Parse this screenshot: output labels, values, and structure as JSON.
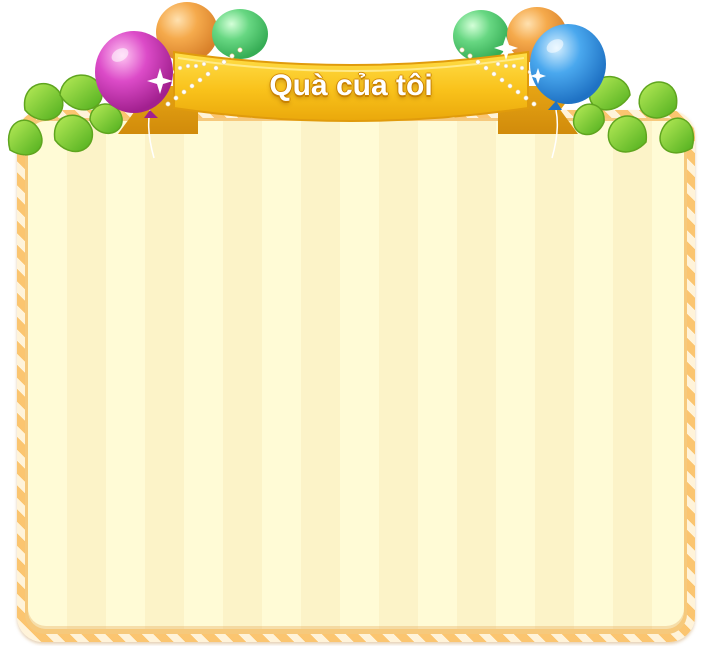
{
  "title": "Quà của tôi",
  "colors": {
    "panel_stripe_light": "#fffbd6",
    "panel_stripe_dark": "#fcf3c8",
    "border_orange": "#fbc570",
    "ribbon_yellow": "#f7c21c",
    "leaf_green": "#7ccf2a"
  },
  "balloons": [
    {
      "name": "pink-balloon",
      "color": "#d33fc1"
    },
    {
      "name": "orange-balloon",
      "color": "#f2a347"
    },
    {
      "name": "green-balloon",
      "color": "#5fd27c"
    },
    {
      "name": "blue-balloon",
      "color": "#3f9fe8"
    }
  ]
}
